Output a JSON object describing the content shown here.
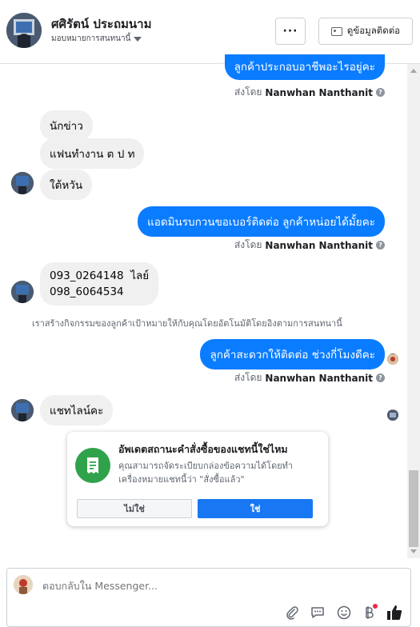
{
  "header": {
    "name": "ศศิรัตน์ ประถมนาม",
    "assign_label": "มอบหมายการสนทนานี้",
    "more_label": "···",
    "contact_label": "ดูข้อมูลติดต่อ"
  },
  "messages": {
    "out_1": "ลูกค้าประกอบอาชีพอะไรอยู่คะ",
    "in_1": "นักข่าว",
    "in_2": "แฟนทำงาน ต ป ท",
    "in_3": "ใต้หวัน",
    "out_2": "แอดมินรบกวนขอเบอร์ติดต่อ ลูกค้าหน่อยได้มั้ยคะ",
    "in_4_line1": "093_0264148  ไลย์",
    "in_4_line2": "098_6064534",
    "system_note": "เราสร้างกิจกรรมของลูกค้าเป้าหมายให้กับคุณโดยอัตโนมัติโดยอิงตามการสนทนานี้",
    "out_3": "ลูกค้าสะดวกให้ติดต่อ ช่วงกี่โมงดีคะ",
    "in_5": "แชทไลน์คะ"
  },
  "sent_by": {
    "prefix": "ส่งโดย",
    "name": "Nanwhan Nanthanit",
    "help_icon": "?"
  },
  "prompt_card": {
    "title": "อัพเดตสถานะคำสั่งซื้อของแชทนี้ใช่ไหม",
    "body": "คุณสามารถจัดระเบียบกล่องข้อความได้โดยทำเครื่องหมายแชทนี้ว่า \"สั่งซื้อแล้ว\"",
    "no_label": "ไม่ใช่",
    "yes_label": "ใช่",
    "icon": "receipt-icon"
  },
  "composer": {
    "placeholder": "ตอบกลับใน Messenger..."
  },
  "colors": {
    "outgoing_bubble": "#0a7cff",
    "incoming_bubble": "#f0f0f0",
    "primary_button": "#1877f2",
    "badge_green": "#31a24c"
  }
}
